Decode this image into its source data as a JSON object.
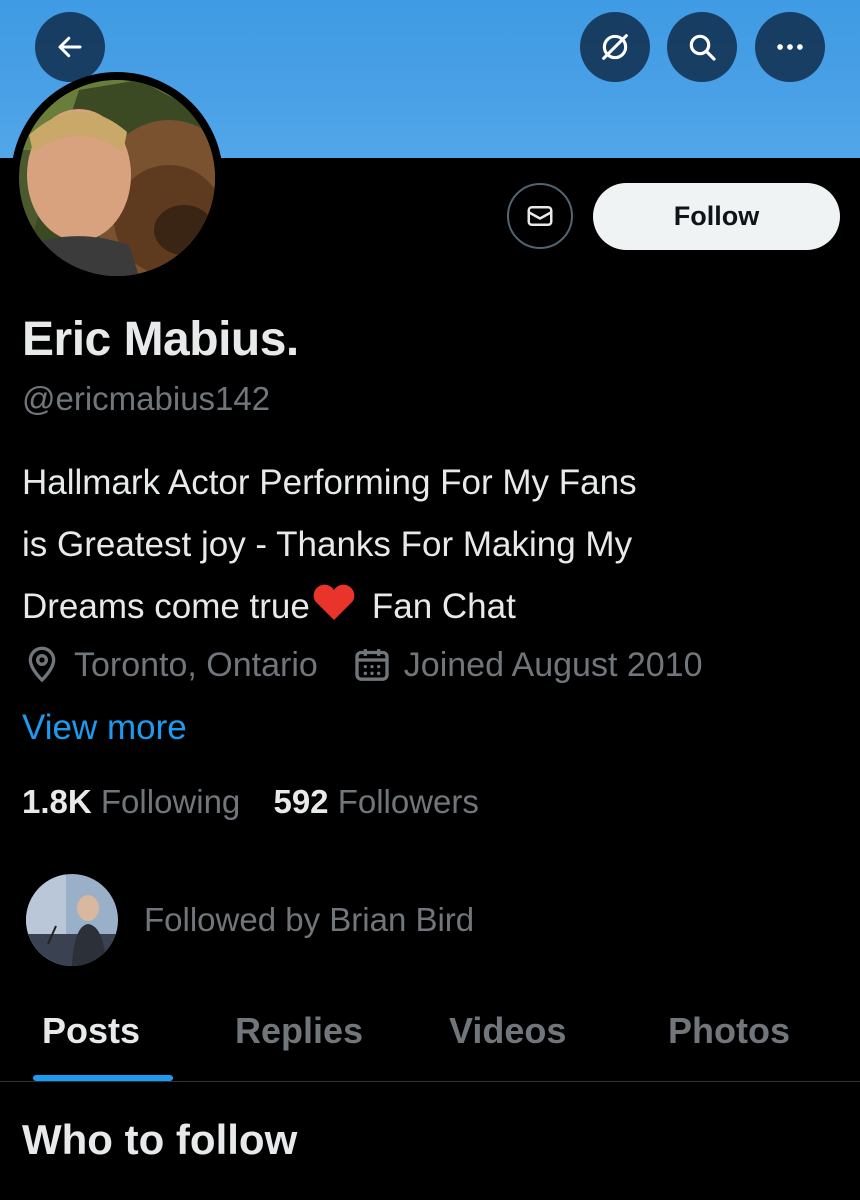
{
  "header": {
    "back_icon": "arrow-left-icon",
    "grok_icon": "grok-icon",
    "search_icon": "search-icon",
    "more_icon": "more-horizontal-icon",
    "banner_color": "#4aa0e6"
  },
  "profile": {
    "name": "Eric Mabius.",
    "handle": "@ericmabius142",
    "bio_lines": [
      "Hallmark Actor Performing For My Fans",
      "is Greatest joy - Thanks For Making My",
      "Dreams come true"
    ],
    "bio_tail": "Fan Chat",
    "location": "Toronto, Ontario",
    "joined": "Joined August 2010",
    "view_more": "View more",
    "following_count": "1.8K",
    "following_label": "Following",
    "followers_count": "592",
    "followers_label": "Followers",
    "followed_by": "Followed by Brian Bird"
  },
  "actions": {
    "follow_label": "Follow",
    "message_icon": "envelope-icon"
  },
  "tabs": [
    {
      "label": "Posts",
      "active": true
    },
    {
      "label": "Replies",
      "active": false
    },
    {
      "label": "Videos",
      "active": false
    },
    {
      "label": "Photos",
      "active": false
    }
  ],
  "section": {
    "who_to_follow": "Who to follow"
  },
  "colors": {
    "accent": "#1d9bf0",
    "muted_text": "#71767b",
    "primary_text": "#e7e9ea"
  }
}
